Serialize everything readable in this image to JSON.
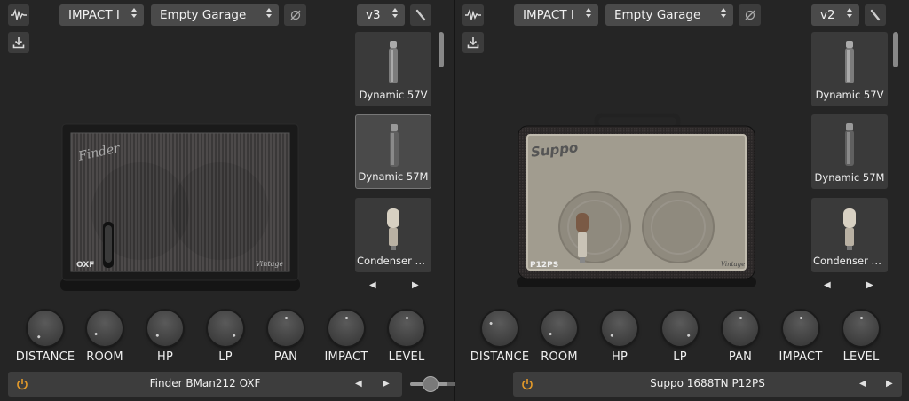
{
  "left": {
    "amp_select": "IMPACT I",
    "room_select": "Empty Garage",
    "mic_version": "v3",
    "mics": [
      {
        "label": "Dynamic 57V",
        "selected": false
      },
      {
        "label": "Dynamic 57M",
        "selected": true
      },
      {
        "label": "Condenser U..."
      }
    ],
    "cabinet": {
      "brand_badge": "OXF",
      "vintage_badge": "Vintage",
      "logo": "Finder"
    },
    "knobs": [
      "DISTANCE",
      "ROOM",
      "HP",
      "LP",
      "PAN",
      "IMPACT",
      "LEVEL"
    ],
    "preset": "Finder BMan212 OXF"
  },
  "right": {
    "amp_select": "IMPACT I",
    "room_select": "Empty Garage",
    "mic_version": "v2",
    "mics": [
      {
        "label": "Dynamic 57V"
      },
      {
        "label": "Dynamic 57M"
      },
      {
        "label": "Condenser U..."
      }
    ],
    "cabinet": {
      "brand_badge": "P12PS",
      "vintage_badge": "Vintage",
      "logo": "Suppo"
    },
    "knobs": [
      "DISTANCE",
      "ROOM",
      "HP",
      "LP",
      "PAN",
      "IMPACT",
      "LEVEL"
    ],
    "preset": "Suppo 1688TN P12PS"
  },
  "mix_slider": {
    "value_fraction": 0.4
  },
  "colors": {
    "panel": "#252525",
    "control": "#4a4a4a",
    "accent_power": "#e39a2a"
  },
  "icons": {
    "waveform": "waveform-icon",
    "download": "download-icon",
    "phase": "phase-invert-icon",
    "mic_tool": "mic-angle-icon",
    "power": "power-icon"
  }
}
